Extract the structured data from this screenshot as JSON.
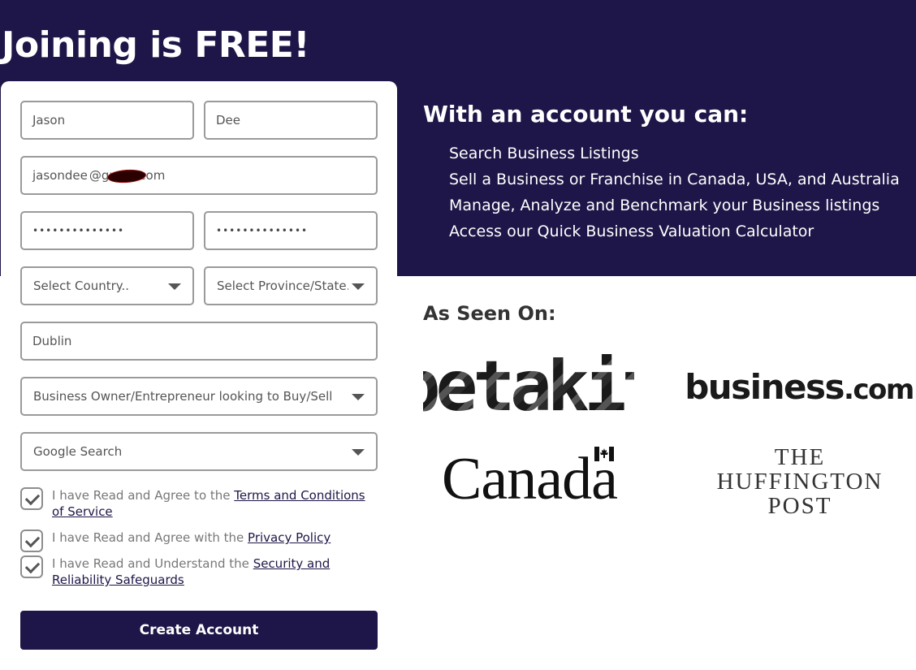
{
  "header": {
    "title": "Joining is FREE!"
  },
  "form": {
    "first_name": "Jason",
    "last_name": "Dee",
    "email_prefix": "jasondee",
    "email_suffix": "@gmail.com",
    "password": "••••••••••••••",
    "password_confirm": "••••••••••••••",
    "country": "Select Country..",
    "province": "Select Province/State..",
    "city": "Dublin",
    "role": "Business Owner/Entrepreneur looking to Buy/Sell",
    "source": "Google Search",
    "agreements": [
      {
        "text": "I have Read and Agree to the ",
        "link": "Terms and Conditions of Service",
        "checked": true
      },
      {
        "text": "I have Read and Agree with the ",
        "link": "Privacy Policy",
        "checked": true
      },
      {
        "text": "I have Read and Understand the ",
        "link": "Security and Reliability Safeguards",
        "checked": true
      }
    ],
    "submit_label": "Create Account"
  },
  "benefits": {
    "title": "With an account you can:",
    "items": [
      "Search Business Listings",
      "Sell a Business or Franchise in Canada, USA, and Australia",
      "Manage, Analyze and Benchmark your Business listings",
      "Access our Quick Business Valuation Calculator"
    ]
  },
  "seen_on": {
    "title": "As Seen On:",
    "logos": {
      "betakit": "betakit",
      "business_main": "business",
      "business_tld": ".com",
      "canada": "Canada",
      "huffington": [
        "THE",
        "HUFFINGTON",
        "POST"
      ]
    }
  },
  "colors": {
    "brand": "#1e1648",
    "border": "#9a9a9a"
  }
}
